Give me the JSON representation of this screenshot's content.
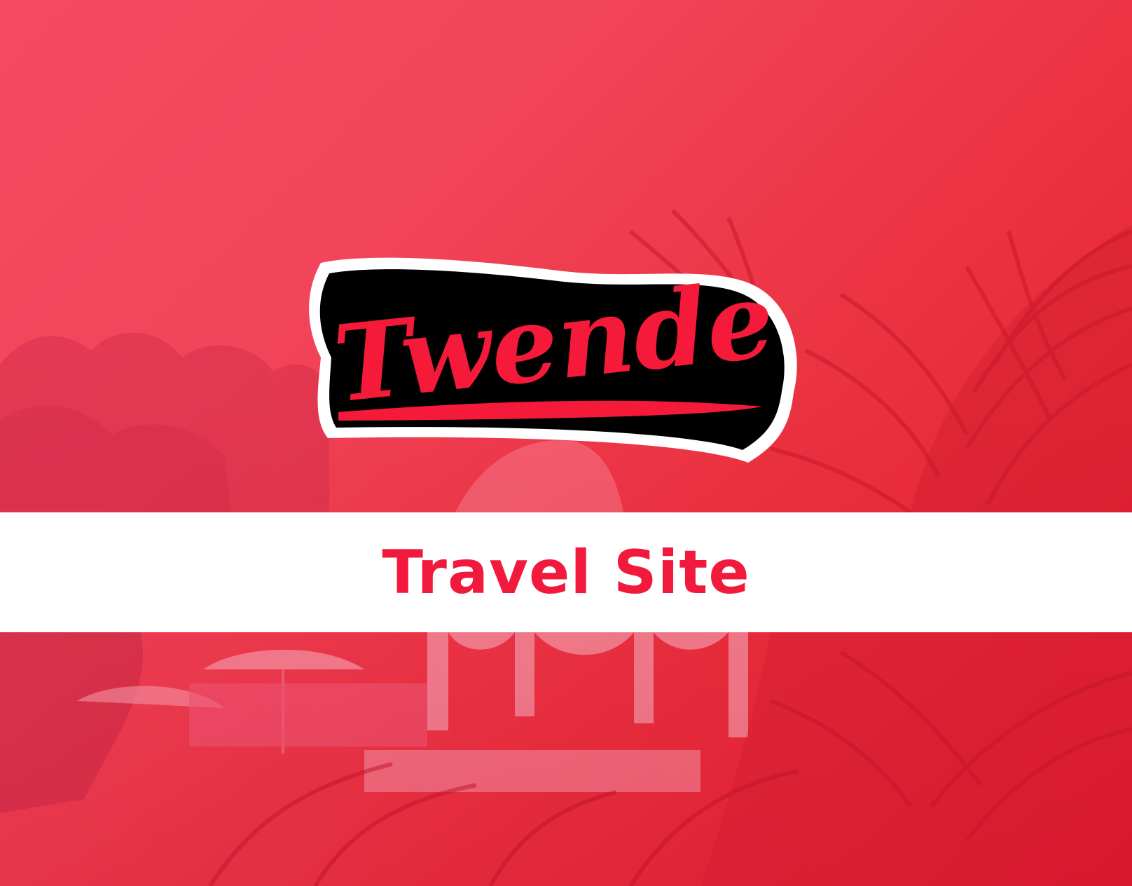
{
  "brand": {
    "logo_text": "Twende",
    "logo_text_color": "#f51a3a",
    "logo_outline_color": "#000000",
    "logo_border_color": "#ffffff"
  },
  "banner": {
    "title": "Travel Site",
    "title_color": "#f21a3c",
    "background": "#ffffff"
  },
  "background": {
    "overlay_color_start": "#f54a62",
    "overlay_color_end": "#e31b2b",
    "scene": "tropical resort with palm trees, pool and white arches"
  }
}
